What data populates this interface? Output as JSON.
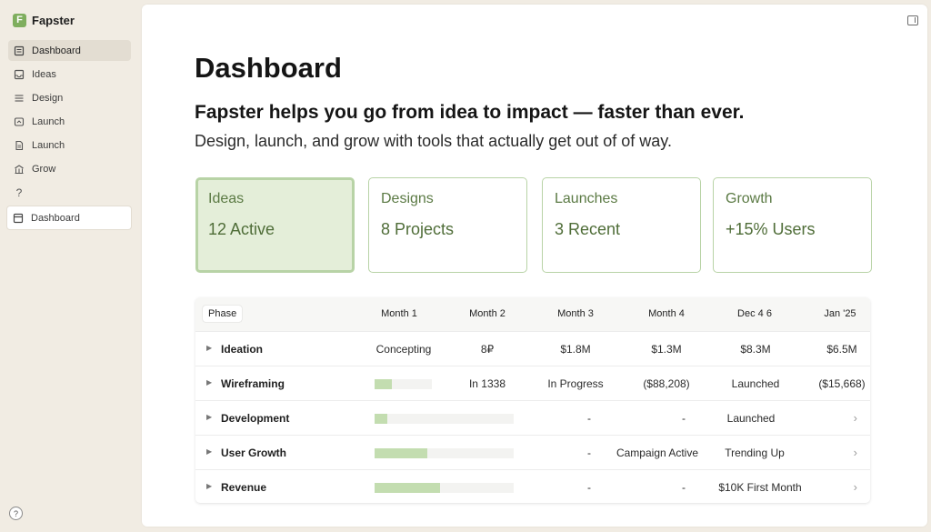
{
  "app": {
    "name": "Fapster",
    "logo_letter": "F"
  },
  "sidebar": {
    "items": [
      {
        "label": "Dashboard",
        "icon": "dashboard-icon"
      },
      {
        "label": "Ideas",
        "icon": "inbox-icon"
      },
      {
        "label": "Design",
        "icon": "list-icon"
      },
      {
        "label": "Launch",
        "icon": "rocket-icon"
      },
      {
        "label": "Launch",
        "icon": "document-icon"
      },
      {
        "label": "Grow",
        "icon": "building-icon"
      },
      {
        "label": "",
        "icon": "question-icon"
      },
      {
        "label": "Dashboard",
        "icon": "calendar-icon"
      }
    ],
    "help_label": "?"
  },
  "main": {
    "title": "Dashboard",
    "headline": "Fapster helps you go from idea to impact — faster than ever.",
    "subline": "Design, launch, and grow with tools that actually get out of of way."
  },
  "cards": [
    {
      "label": "Ideas",
      "value": "12 Active"
    },
    {
      "label": "Designs",
      "value": "8 Projects"
    },
    {
      "label": "Launches",
      "value": "3 Recent"
    },
    {
      "label": "Growth",
      "value": "+15% Users"
    }
  ],
  "table": {
    "phase_header": "Phase",
    "columns": [
      "Month 1",
      "Month 2",
      "Month 3",
      "Month 4",
      "Dec 4 6",
      "Jan '25"
    ],
    "rows": [
      {
        "phase": "Ideation",
        "cells": [
          "Concepting",
          "8₽",
          "$1.8M",
          "$1.3M",
          "$8.3M",
          "$6.5M"
        ],
        "bar": null
      },
      {
        "phase": "Wireframing",
        "cells": [
          "",
          "In 1338",
          "In Progress",
          "($88,208)",
          "Launched",
          "($15,668)"
        ],
        "bar": 0.3
      },
      {
        "phase": "Development",
        "cells": [
          "",
          "",
          "-",
          "-",
          "Launched",
          ""
        ],
        "bar": 0.09
      },
      {
        "phase": "User Growth",
        "cells": [
          "",
          "",
          "-",
          "Campaign Active",
          "Trending Up",
          ""
        ],
        "bar": 0.38
      },
      {
        "phase": "Revenue",
        "cells": [
          "",
          "",
          "-",
          "-",
          "$10K First Month",
          ""
        ],
        "bar": 0.47
      }
    ]
  },
  "colors": {
    "accent": "#7fae5e",
    "card_border": "#b8d3a6",
    "card_text": "#5b7a44",
    "bar_fill": "#c3ddb0"
  }
}
